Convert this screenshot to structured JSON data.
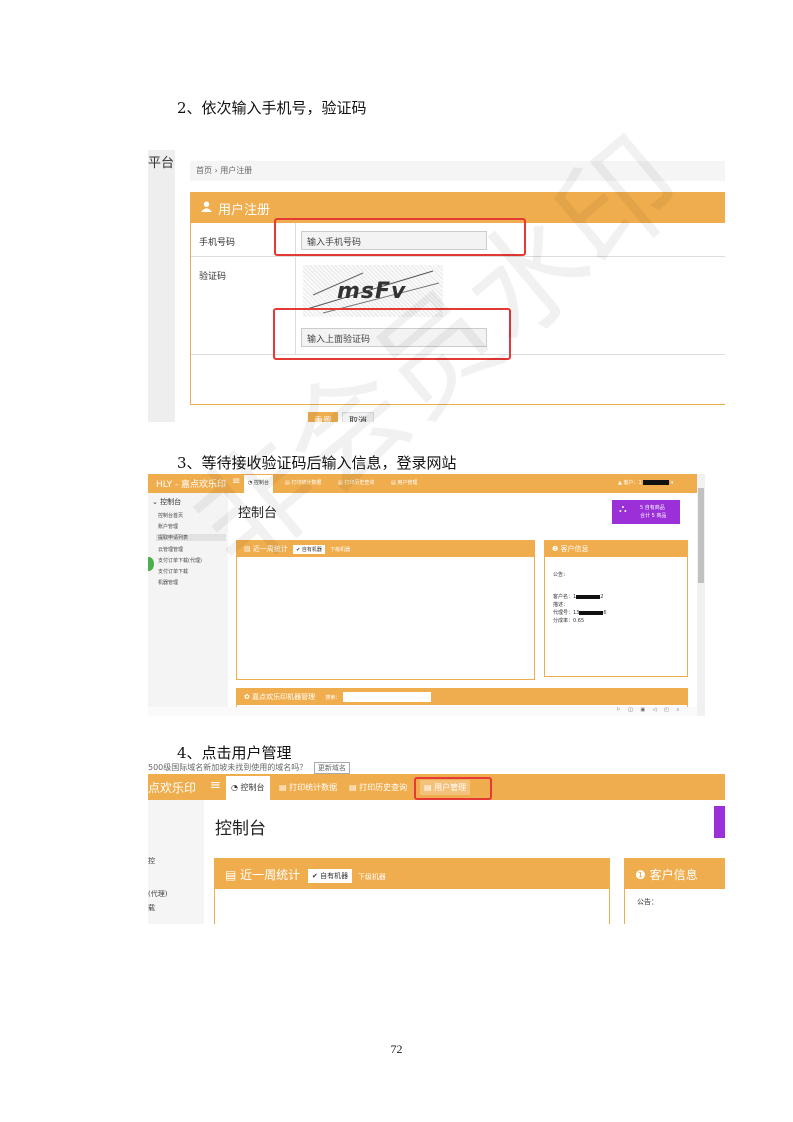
{
  "steps": {
    "step2": "2、依次输入手机号，验证码",
    "step3": "3、等待接收验证码后输入信息，登录网站",
    "step4": "4、点击用户管理"
  },
  "watermark": "非会员水印",
  "page_number": "72",
  "shot1": {
    "platform_text": "平台",
    "breadcrumb": "首页 › 用户注册",
    "panel_title": "用户注册",
    "phone_label": "手机号码",
    "phone_placeholder": "输入手机号码",
    "captcha_label": "验证码",
    "captcha_text": "msFv",
    "captcha_placeholder": "输入上面验证码",
    "reset_button": "重置",
    "cancel_button": "取消"
  },
  "shot2": {
    "brand": "HLY - 嘉点欢乐印",
    "nav": [
      "控制台",
      "打印统计数据",
      "打印历史查询",
      "用户管理"
    ],
    "user_chip": "客户：1",
    "sidebar_head": "控制台",
    "sidebar": [
      "控制台首页",
      "账户管理",
      "提取申请列表",
      "云管理管理",
      "支付订单下载(代理)",
      "支付订单下载",
      "机器管理"
    ],
    "page_title": "控制台",
    "purple_line1": "5 自有商品",
    "purple_line2": "合计 5 商品",
    "stats_title": "近一周统计",
    "own_machines": "自有机器",
    "sub_machines": "下级机器",
    "customer_title": "客户信息",
    "notice": "公告：",
    "customer_name": "客户名：1",
    "customer_name_tail": "2",
    "description": "描述：",
    "agent_no": "代理号：13",
    "agent_no_tail": "6",
    "commission": "分成率：0.65",
    "machine_mgmt": "嘉点欢乐印机器管理",
    "search_label": "搜索："
  },
  "shot3": {
    "url_text": "500级国际域名新加坡未找到使用的域名吗？",
    "url_button": "更新域名",
    "brand": "点欢乐印",
    "nav": [
      "控制台",
      "打印统计数据",
      "打印历史查询",
      "用户管理"
    ],
    "sidebar": [
      "控",
      "(代理)",
      "载"
    ],
    "page_title": "控制台",
    "stats_title": "近一周统计",
    "own_machines": "自有机器",
    "sub_machines": "下级机器",
    "customer_title": "客户信息",
    "notice": "公告："
  },
  "colors": {
    "accent": "#f0ad4e",
    "highlight": "#e53935",
    "purple": "#9b30d9"
  }
}
